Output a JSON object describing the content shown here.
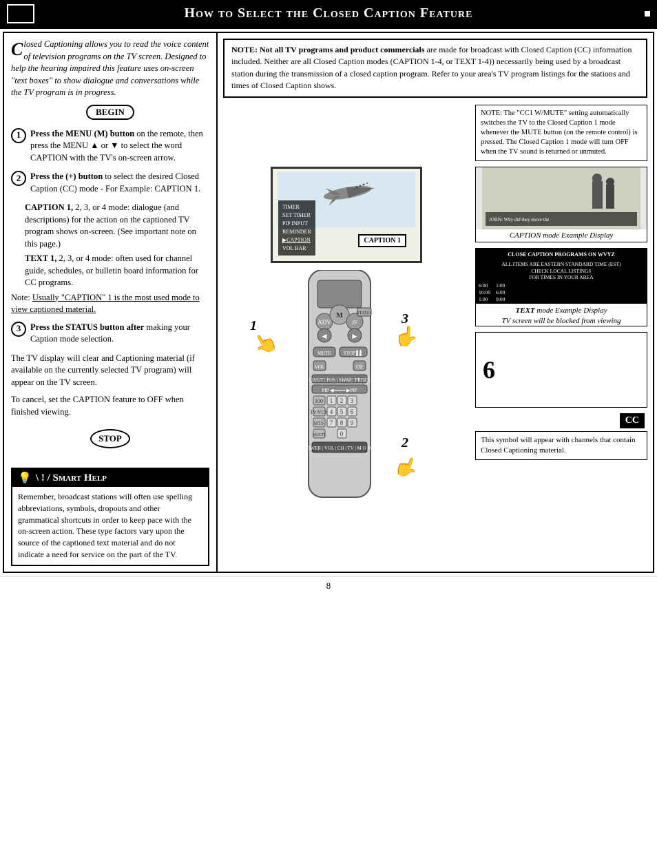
{
  "header": {
    "title": "How to Select the Closed Caption Feature"
  },
  "top_note": {
    "text": "NOTE: Not all TV programs and product commercials are made for broadcast with Closed Caption (CC) information included. Neither are all Closed Caption modes (CAPTION 1-4, or TEXT 1-4)) necessarily being used by a broadcast station during the transmission of a closed caption program. Refer to your area's TV program listings for the stations and times of Closed Caption shows."
  },
  "intro": {
    "text": "losed Captioning allows you to read the voice content of television programs on the TV screen. Designed to help the hearing impaired this feature uses on-screen \"text boxes\" to show dialogue and conversations while the TV program is in progress.",
    "drop_cap": "C"
  },
  "begin_label": "BEGIN",
  "steps": [
    {
      "number": "1",
      "label": "step-1",
      "text_parts": [
        {
          "bold": true,
          "text": "Press the MENU (M) button"
        },
        {
          "bold": false,
          "text": " on the remote, then press the MENU ▲ or ▼ to select the word CAPTION with the TV's on-screen arrow."
        }
      ]
    },
    {
      "number": "2",
      "label": "step-2",
      "text_parts": [
        {
          "bold": true,
          "text": "Press the (+) button"
        },
        {
          "bold": false,
          "text": " to select the desired Closed Caption (CC) mode - For Example: CAPTION 1."
        }
      ],
      "sub_items": [
        {
          "label": "CAPTION 1,",
          "rest": " 2, 3, or 4 mode: dialogue (and descriptions) for the action on the captioned TV program shows on-screen. (See important note on this page.)"
        },
        {
          "label": "TEXT 1,",
          "rest": " 2, 3, or 4 mode: often used for channel guide, schedules, or bulletin board information for CC programs."
        }
      ],
      "note": "Note: Usually \"CAPTION\" 1 is the most used mode to view captioned material."
    },
    {
      "number": "3",
      "label": "step-3",
      "text_parts": [
        {
          "bold": true,
          "text": "Press the STATUS button after"
        },
        {
          "bold": false,
          "text": " making your Caption mode selection."
        }
      ],
      "extra": [
        "The TV display will clear and Captioning material  (if available on the currently selected TV program) will appear on the TV screen.",
        "To cancel, set the CAPTION feature to OFF when finished viewing."
      ]
    }
  ],
  "stop_label": "STOP",
  "smart_help": {
    "title": "Smart Help",
    "text": "Remember, broadcast stations will often use spelling abbreviations, symbols, dropouts and other grammatical shortcuts in order to keep pace with the on-screen action. These type factors vary upon the source of the captioned text material and do not indicate a need for service on the part of the TV."
  },
  "side_note": {
    "text": "NOTE: The \"CC1 W/MUTE\" setting automatically switches the TV to the Closed Caption 1 mode whenever the MUTE button (on the remote control) is pressed. The Closed Caption 1 mode will turn OFF  when the TV sound is returned or unmuted."
  },
  "caption_example": {
    "label": "CAPTION mode Example Display"
  },
  "text_example": {
    "label": "TEXT mode Example Display\nTV screen will be blocked from viewing",
    "lines": [
      "CLOSE CAPTION PROGRAMS ON WVYZ",
      "ALL ITEMS ARE EASTERN STANDARD TIME (EST)",
      "CHECK LOCAL LISTINGS",
      "FOR TIMES IN YOUR AREA",
      "6:00",
      "10:00",
      "1:00",
      "1:00",
      "6:00",
      "9:00"
    ]
  },
  "number_six": "6",
  "cc_symbol": "CC",
  "cc_note": "This symbol will appear with channels that contain Closed Captioning material.",
  "tv_menu_items": [
    "TIMER",
    "SET TIMER",
    "PIP INPUT",
    "REMINDER",
    "CAPTION",
    "VOL BAR"
  ],
  "caption1_label": "CAPTION 1",
  "page_number": "8",
  "diagram_numbers": [
    "1",
    "2",
    "3"
  ]
}
